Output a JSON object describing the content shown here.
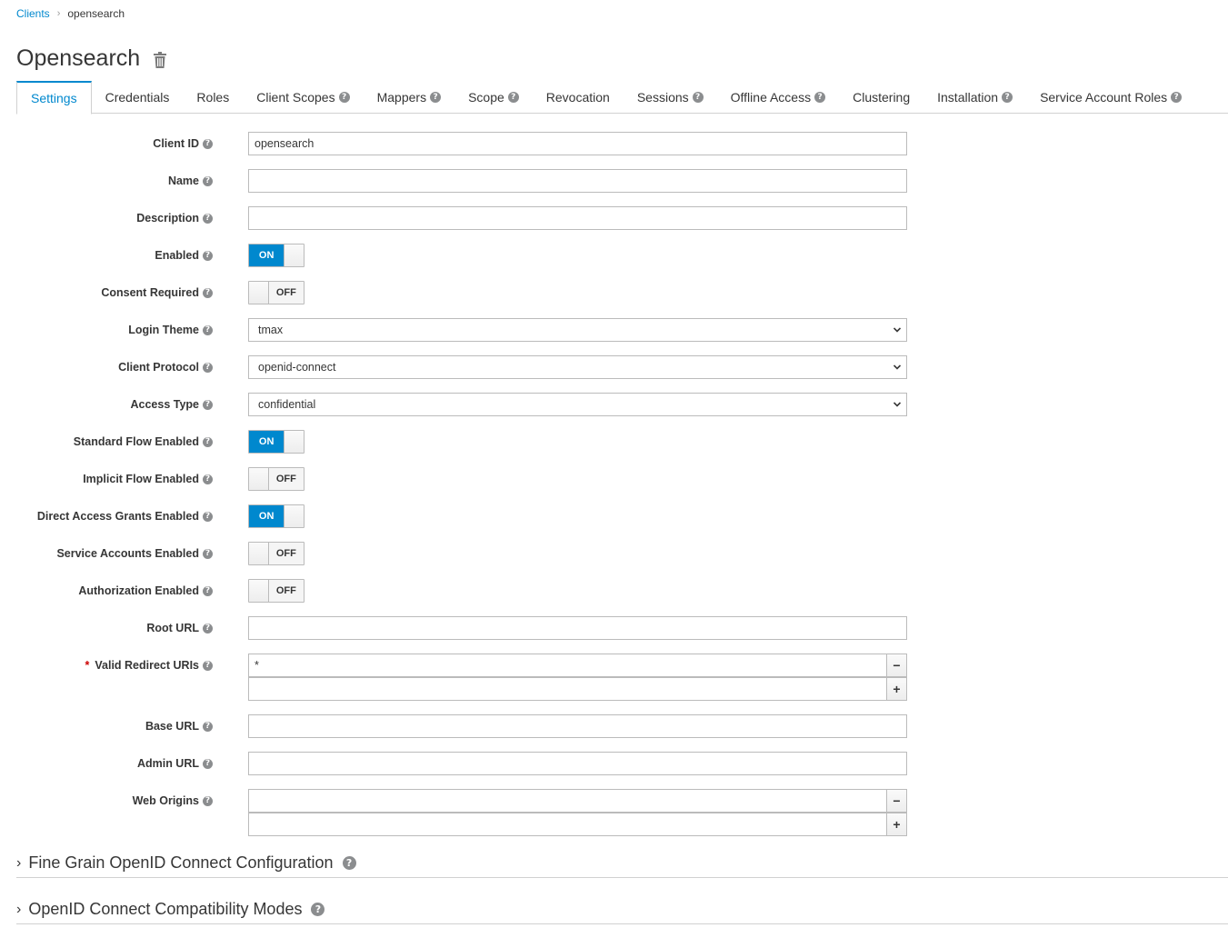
{
  "breadcrumb": {
    "root": "Clients",
    "current": "opensearch"
  },
  "title": "Opensearch",
  "tabs": [
    "Settings",
    "Credentials",
    "Roles",
    "Client Scopes",
    "Mappers",
    "Scope",
    "Revocation",
    "Sessions",
    "Offline Access",
    "Clustering",
    "Installation",
    "Service Account Roles"
  ],
  "form": {
    "client_id": {
      "label": "Client ID",
      "value": "opensearch"
    },
    "name": {
      "label": "Name",
      "value": ""
    },
    "description": {
      "label": "Description",
      "value": ""
    },
    "enabled": {
      "label": "Enabled",
      "state": "ON"
    },
    "consent_required": {
      "label": "Consent Required",
      "state": "OFF"
    },
    "login_theme": {
      "label": "Login Theme",
      "value": "tmax"
    },
    "client_protocol": {
      "label": "Client Protocol",
      "value": "openid-connect"
    },
    "access_type": {
      "label": "Access Type",
      "value": "confidential"
    },
    "standard_flow": {
      "label": "Standard Flow Enabled",
      "state": "ON"
    },
    "implicit_flow": {
      "label": "Implicit Flow Enabled",
      "state": "OFF"
    },
    "direct_access": {
      "label": "Direct Access Grants Enabled",
      "state": "ON"
    },
    "service_accounts": {
      "label": "Service Accounts Enabled",
      "state": "OFF"
    },
    "authorization": {
      "label": "Authorization Enabled",
      "state": "OFF"
    },
    "root_url": {
      "label": "Root URL",
      "value": ""
    },
    "redirect_uris": {
      "label": "Valid Redirect URIs",
      "required_mark": "*",
      "values": [
        "*",
        ""
      ]
    },
    "base_url": {
      "label": "Base URL",
      "value": ""
    },
    "admin_url": {
      "label": "Admin URL",
      "value": ""
    },
    "web_origins": {
      "label": "Web Origins",
      "values": [
        "",
        ""
      ]
    }
  },
  "buttons": {
    "remove": "−",
    "add": "+"
  },
  "sections": {
    "fine_grain": "Fine Grain OpenID Connect Configuration",
    "compat": "OpenID Connect Compatibility Modes"
  },
  "colors": {
    "accent": "#0088ce",
    "required": "#cc0000"
  }
}
